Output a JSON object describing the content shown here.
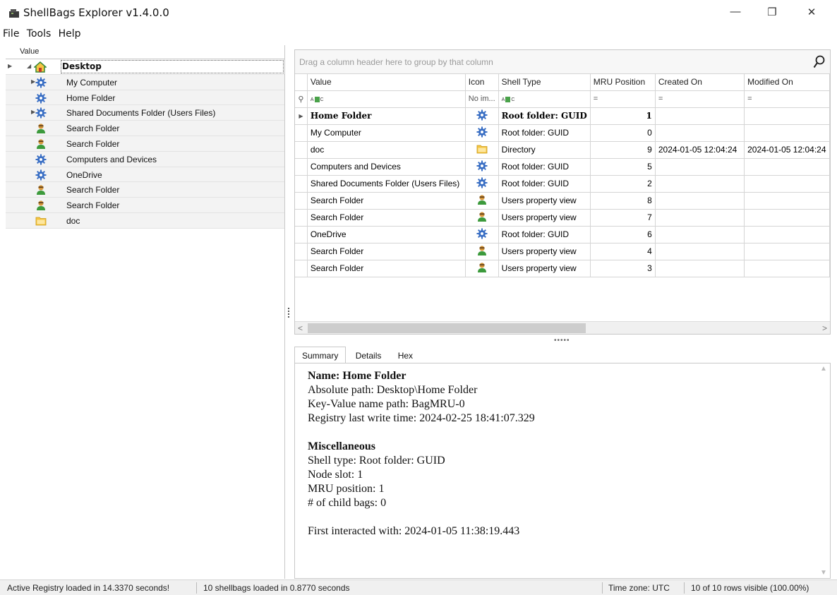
{
  "window": {
    "title": "ShellBags Explorer v1.4.0.0",
    "minimize": "—",
    "restore": "❐",
    "close": "✕"
  },
  "menu": [
    "File",
    "Tools",
    "Help"
  ],
  "tree": {
    "header": "Value",
    "root": "Desktop",
    "items": [
      {
        "label": "My Computer",
        "icon": "gear-icon",
        "expandable": true
      },
      {
        "label": "Home Folder",
        "icon": "gear-icon",
        "expandable": false
      },
      {
        "label": "Shared Documents Folder (Users Files)",
        "icon": "gear-icon",
        "expandable": true
      },
      {
        "label": "Search Folder",
        "icon": "user-icon",
        "expandable": false
      },
      {
        "label": "Search Folder",
        "icon": "user-icon",
        "expandable": false
      },
      {
        "label": "Computers and Devices",
        "icon": "gear-icon",
        "expandable": false
      },
      {
        "label": "OneDrive",
        "icon": "gear-icon",
        "expandable": false
      },
      {
        "label": "Search Folder",
        "icon": "user-icon",
        "expandable": false
      },
      {
        "label": "Search Folder",
        "icon": "user-icon",
        "expandable": false
      },
      {
        "label": "doc",
        "icon": "folder-icon",
        "expandable": false
      }
    ]
  },
  "grid": {
    "group_hint": "Drag a column header here to group by that column",
    "columns": [
      "Value",
      "Icon",
      "Shell Type",
      "MRU Position",
      "Created On",
      "Modified On"
    ],
    "filter": {
      "icon_text": "No im...",
      "eq": "="
    },
    "rows": [
      {
        "value": "Home Folder",
        "icon": "gear-icon",
        "type": "Root folder: GUID",
        "mru": "1",
        "created": "",
        "modified": ""
      },
      {
        "value": "My Computer",
        "icon": "gear-icon",
        "type": "Root folder: GUID",
        "mru": "0",
        "created": "",
        "modified": ""
      },
      {
        "value": "doc",
        "icon": "folder-icon",
        "type": "Directory",
        "mru": "9",
        "created": "2024-01-05 12:04:24",
        "modified": "2024-01-05 12:04:24"
      },
      {
        "value": "Computers and Devices",
        "icon": "gear-icon",
        "type": "Root folder: GUID",
        "mru": "5",
        "created": "",
        "modified": ""
      },
      {
        "value": "Shared Documents Folder (Users Files)",
        "icon": "gear-icon",
        "type": "Root folder: GUID",
        "mru": "2",
        "created": "",
        "modified": ""
      },
      {
        "value": "Search Folder",
        "icon": "user-icon",
        "type": "Users property view",
        "mru": "8",
        "created": "",
        "modified": ""
      },
      {
        "value": "Search Folder",
        "icon": "user-icon",
        "type": "Users property view",
        "mru": "7",
        "created": "",
        "modified": ""
      },
      {
        "value": "OneDrive",
        "icon": "gear-icon",
        "type": "Root folder: GUID",
        "mru": "6",
        "created": "",
        "modified": ""
      },
      {
        "value": "Search Folder",
        "icon": "user-icon",
        "type": "Users property view",
        "mru": "4",
        "created": "",
        "modified": ""
      },
      {
        "value": "Search Folder",
        "icon": "user-icon",
        "type": "Users property view",
        "mru": "3",
        "created": "",
        "modified": ""
      }
    ]
  },
  "tabs": [
    "Summary",
    "Details",
    "Hex"
  ],
  "summary": {
    "name": "Name: Home Folder",
    "abs_path": "Absolute path: Desktop\\Home Folder",
    "key_value": "Key-Value name path: BagMRU-0",
    "reg_time": "Registry last write time: 2024-02-25 18:41:07.329",
    "misc": "Miscellaneous",
    "shell_type": "Shell type: Root folder: GUID",
    "node_slot": "Node slot: 1",
    "mru_pos": "MRU position: 1",
    "child_bags": "# of child bags: 0",
    "first_interacted": "First interacted with: 2024-01-05 11:38:19.443"
  },
  "status": {
    "registry": "Active Registry loaded in 14.3370 seconds!",
    "shellbags": "10 shellbags loaded in 0.8770 seconds",
    "timezone": "Time zone: UTC",
    "rows": "10 of 10 rows visible (100.00%)"
  },
  "colors": {
    "gear": "#3a6fc4",
    "user_body": "#3c9a3c",
    "user_head": "#d4963a",
    "folder": "#f5c542",
    "filter_green": "#4aa24a"
  }
}
